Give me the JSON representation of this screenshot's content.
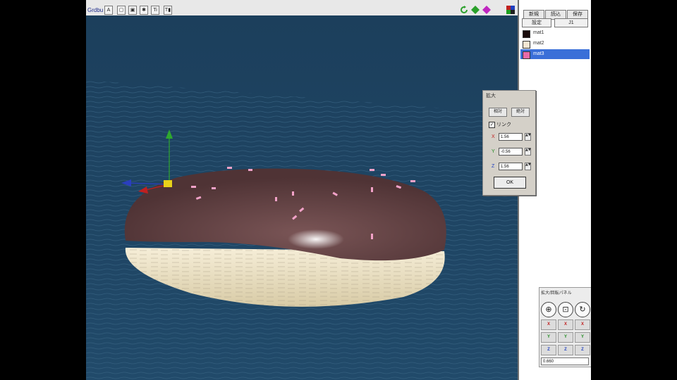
{
  "toolbar": {
    "app_label": "Grdbu",
    "buttons": [
      "A",
      "▢",
      "▣",
      "✱",
      "Ti",
      "T▮"
    ]
  },
  "right_panel": {
    "tabs": [
      "新規",
      "読込",
      "保存"
    ],
    "subtabs": [
      "設定",
      "J1"
    ],
    "materials": [
      {
        "name": "mat1",
        "color": "#1a0c0c",
        "selected": false
      },
      {
        "name": "mat2",
        "color": "#f3e6d2",
        "selected": false
      },
      {
        "name": "mat3",
        "color": "#e86aa8",
        "selected": true
      }
    ]
  },
  "dialog": {
    "title": "拡大",
    "tabs": [
      "相対",
      "絶対"
    ],
    "checkbox_label": "リンク",
    "checked": true,
    "fields": [
      {
        "axis": "X",
        "value": "1.56",
        "color": "#c02020"
      },
      {
        "axis": "Y",
        "value": "-0.56",
        "color": "#1f8a1f"
      },
      {
        "axis": "Z",
        "value": "1.56",
        "color": "#1f3fbf"
      }
    ],
    "ok_label": "OK"
  },
  "move_panel": {
    "title": "拡大/回転パネル",
    "icons": [
      "⊕",
      "⊡",
      "↻"
    ],
    "rows": [
      {
        "label": "X",
        "color": "#c02020"
      },
      {
        "label": "Y",
        "color": "#1f8a1f"
      },
      {
        "label": "Z",
        "color": "#1f3fbf"
      }
    ],
    "value": "0.660"
  },
  "colors": {
    "viewport_bg": "#1e4664",
    "donut_chocolate": "#5a3a3c",
    "donut_dough": "#efe4c8",
    "sprinkles": "#f2a2c8",
    "selection": "#3a6fd8"
  }
}
